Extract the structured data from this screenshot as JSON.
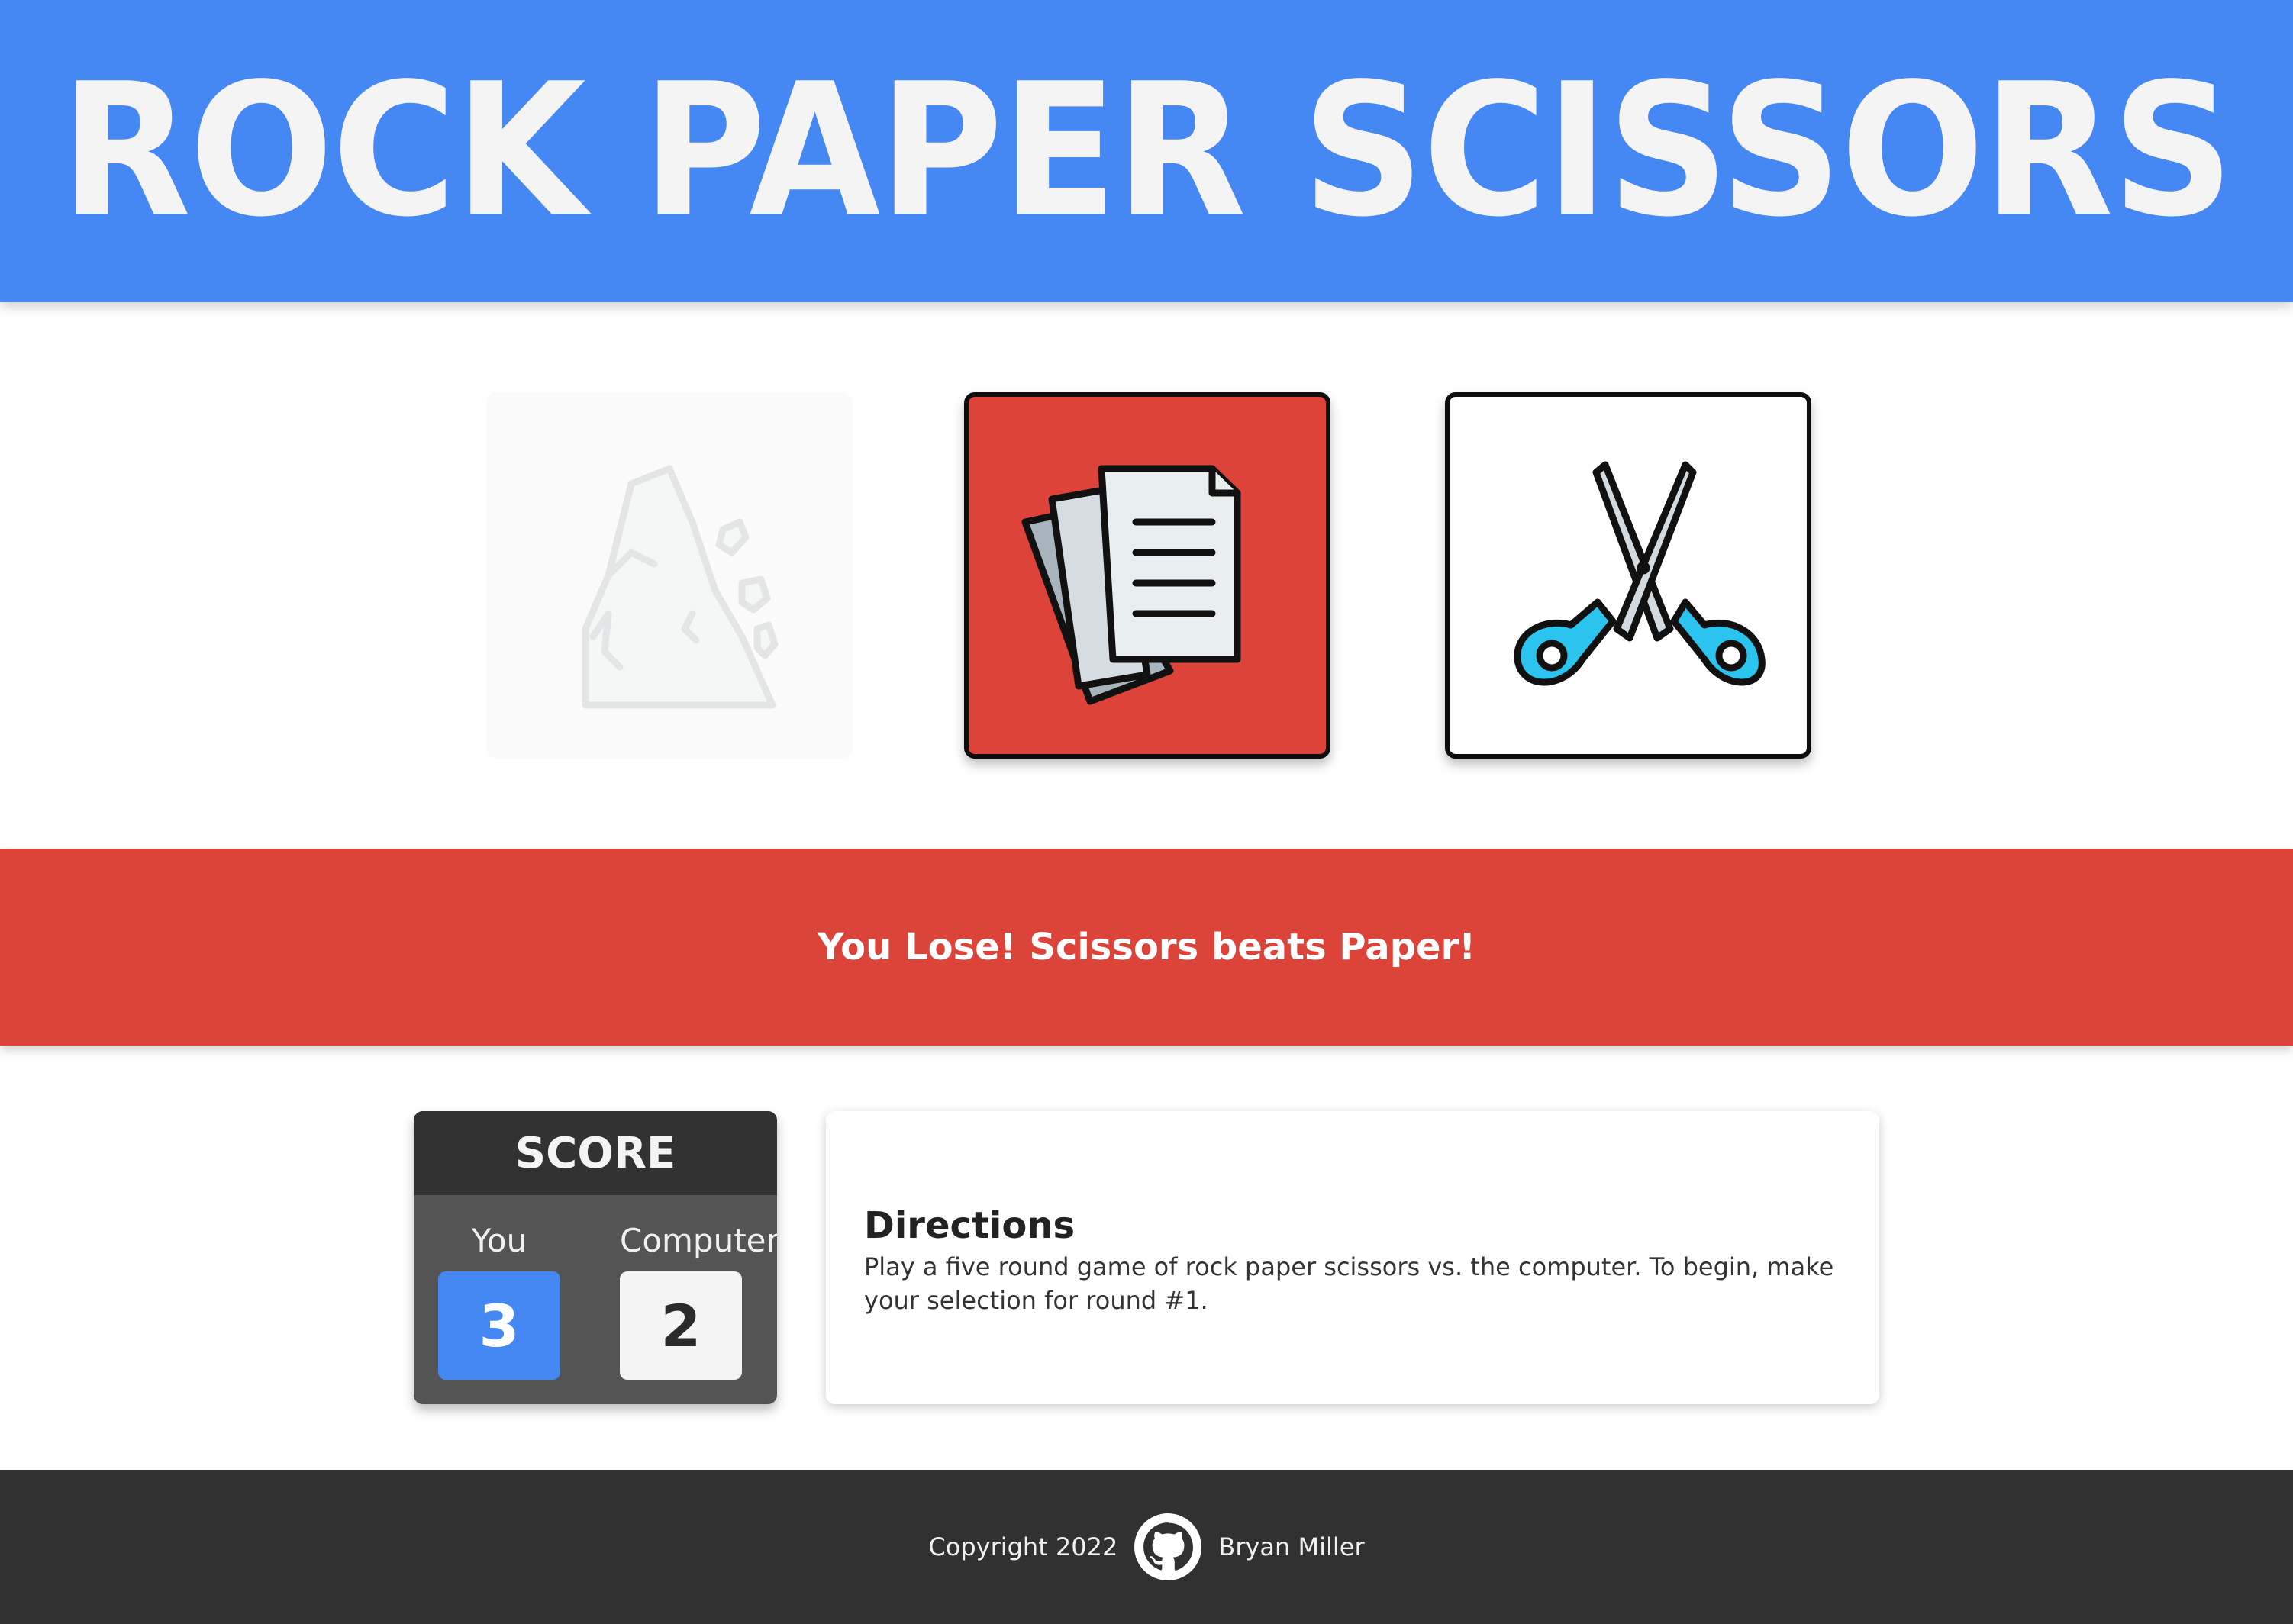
{
  "header": {
    "title": "ROCK PAPER SCISSORS"
  },
  "choices": [
    {
      "name": "Rock",
      "icon": "rock-icon",
      "state": "dimmed"
    },
    {
      "name": "Paper",
      "icon": "paper-icon",
      "state": "player-selected"
    },
    {
      "name": "Scissors",
      "icon": "scissors-icon",
      "state": "computer-selected"
    }
  ],
  "result": {
    "message": "You Lose! Scissors beats Paper!"
  },
  "score": {
    "title": "SCORE",
    "you_label": "You",
    "you_value": "3",
    "computer_label": "Computer",
    "computer_value": "2"
  },
  "directions": {
    "title": "Directions",
    "text": "Play a five round game of rock paper scissors vs. the computer. To begin, make your selection for round #1."
  },
  "footer": {
    "copyright": "Copyright 2022",
    "icon": "github-icon",
    "author": "Bryan Miller"
  },
  "colors": {
    "primary_blue": "#4588f4",
    "lose_red": "#dc443a",
    "dark": "#313131",
    "scissors_handle": "#2bc4ee"
  }
}
